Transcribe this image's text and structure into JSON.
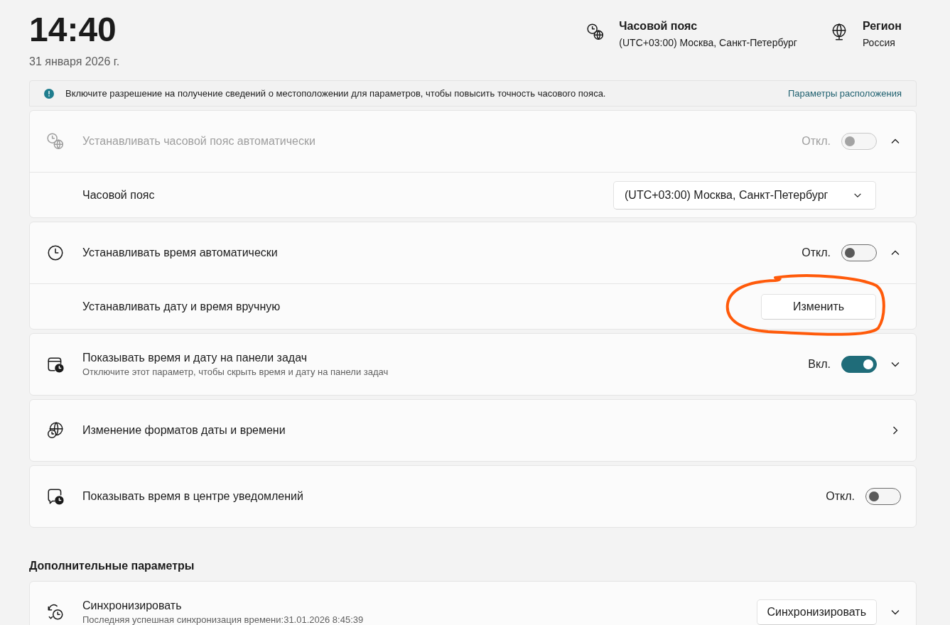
{
  "clock": {
    "time": "14:40",
    "date": "31 января 2026 г."
  },
  "summary": [
    {
      "kind": "timezone",
      "title": "Часовой пояс",
      "value": "(UTC+03:00) Москва, Санкт-Петербург"
    },
    {
      "kind": "region",
      "title": "Регион",
      "value": "Россия"
    }
  ],
  "notice": {
    "text": "Включите разрешение на получение сведений о местоположении для параметров, чтобы повысить точность часового пояса.",
    "link": "Параметры расположения"
  },
  "groups": [
    {
      "rows": [
        {
          "kind": "toggle",
          "label": "Устанавливать часовой пояс автоматически",
          "disabled": true,
          "state_label": "Откл.",
          "on": false,
          "expanded": true
        },
        {
          "kind": "dropdown",
          "label": "Часовой пояс",
          "value": "(UTC+03:00) Москва, Санкт-Петербург"
        }
      ]
    },
    {
      "rows": [
        {
          "kind": "toggle",
          "label": "Устанавливать время автоматически",
          "disabled": false,
          "state_label": "Откл.",
          "on": false,
          "expanded": true
        },
        {
          "kind": "button",
          "label": "Устанавливать дату и время вручную",
          "button": "Изменить"
        }
      ]
    },
    {
      "rows": [
        {
          "kind": "toggle",
          "label": "Показывать время и дату на панели задач",
          "description": "Отключите этот параметр, чтобы скрыть время и дату на панели задач",
          "disabled": false,
          "state_label": "Вкл.",
          "on": true,
          "expanded": false
        }
      ]
    },
    {
      "rows": [
        {
          "kind": "link",
          "label": "Изменение форматов даты и времени"
        }
      ]
    },
    {
      "rows": [
        {
          "kind": "toggle",
          "label": "Показывать время в центре уведомлений",
          "disabled": false,
          "state_label": "Откл.",
          "on": false
        }
      ]
    }
  ],
  "section_title": "Дополнительные параметры",
  "extra_groups": [
    {
      "rows": [
        {
          "kind": "button",
          "label": "Синхронизировать",
          "description": "Последняя успешная синхронизация времени:31.01.2026 8:45:39",
          "button": "Синхронизировать",
          "expanded": false
        }
      ]
    }
  ]
}
